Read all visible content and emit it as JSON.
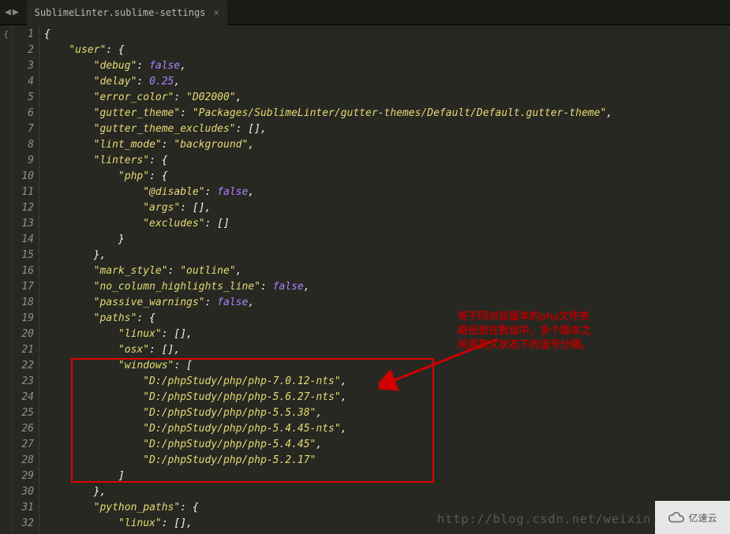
{
  "tab": {
    "title": "SublimeLinter.sublime-settings"
  },
  "fold_marker": "{",
  "gutter": [
    "1",
    "2",
    "3",
    "4",
    "5",
    "6",
    "7",
    "8",
    "9",
    "10",
    "11",
    "12",
    "13",
    "14",
    "15",
    "16",
    "17",
    "18",
    "19",
    "20",
    "21",
    "22",
    "23",
    "24",
    "25",
    "26",
    "27",
    "28",
    "29",
    "30",
    "31",
    "32"
  ],
  "code": {
    "user_key": "\"user\"",
    "debug_key": "\"debug\"",
    "debug_val": "false",
    "delay_key": "\"delay\"",
    "delay_val": "0.25",
    "error_color_key": "\"error_color\"",
    "error_color_val": "\"D02000\"",
    "gutter_theme_key": "\"gutter_theme\"",
    "gutter_theme_val": "\"Packages/SublimeLinter/gutter-themes/Default/Default.gutter-theme\"",
    "gutter_theme_excludes_key": "\"gutter_theme_excludes\"",
    "lint_mode_key": "\"lint_mode\"",
    "lint_mode_val": "\"background\"",
    "linters_key": "\"linters\"",
    "php_key": "\"php\"",
    "atdisable_key": "\"@disable\"",
    "atdisable_val": "false",
    "args_key": "\"args\"",
    "excludes_key": "\"excludes\"",
    "mark_style_key": "\"mark_style\"",
    "mark_style_val": "\"outline\"",
    "no_col_key": "\"no_column_highlights_line\"",
    "no_col_val": "false",
    "passive_key": "\"passive_warnings\"",
    "passive_val": "false",
    "paths_key": "\"paths\"",
    "linux_key": "\"linux\"",
    "osx_key": "\"osx\"",
    "windows_key": "\"windows\"",
    "win_paths": [
      "\"D:/phpStudy/php/php-7.0.12-nts\"",
      "\"D:/phpStudy/php/php-5.6.27-nts\"",
      "\"D:/phpStudy/php/php-5.5.38\"",
      "\"D:/phpStudy/php/php-5.4.45-nts\"",
      "\"D:/phpStudy/php/php-5.4.45\"",
      "\"D:/phpStudy/php/php-5.2.17\""
    ],
    "python_paths_key": "\"python_paths\""
  },
  "annotation_lines": [
    "将不同对应版本的php文件夹",
    "路径放在数组中，多个版本之",
    "间用英文状态下的逗号分隔。"
  ],
  "watermark": "http://blog.csdn.net/weixin",
  "logo_text": "亿速云"
}
